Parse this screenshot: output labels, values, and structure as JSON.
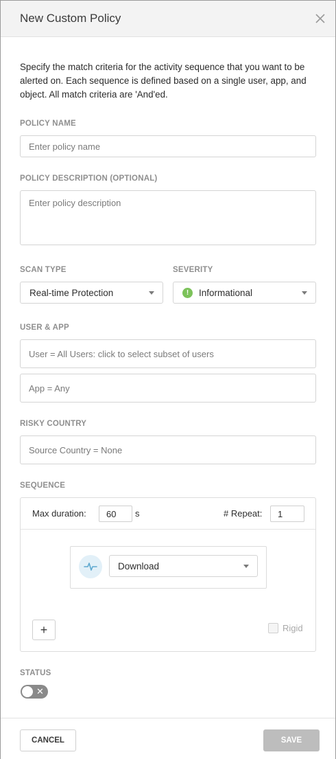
{
  "dialog": {
    "title": "New Custom Policy",
    "intro": "Specify the match criteria for the activity sequence that you want to be alerted on. Each sequence is defined based on a single user, app, and object. All match criteria are 'And'ed."
  },
  "policy_name": {
    "label": "POLICY NAME",
    "placeholder": "Enter policy name"
  },
  "policy_description": {
    "label": "POLICY DESCRIPTION (OPTIONAL)",
    "placeholder": "Enter policy description"
  },
  "scan_type": {
    "label": "SCAN TYPE",
    "value": "Real-time Protection"
  },
  "severity": {
    "label": "SEVERITY",
    "value": "Informational",
    "icon": "info-icon",
    "color": "#7cc25a"
  },
  "user_app": {
    "label": "USER & APP",
    "user": "User = All Users: click to select subset of users",
    "app": "App = Any"
  },
  "risky_country": {
    "label": "RISKY COUNTRY",
    "source": "Source Country = None"
  },
  "sequence": {
    "label": "SEQUENCE",
    "max_duration_label": "Max duration:",
    "max_duration_value": "60",
    "duration_unit": "s",
    "repeat_label": "# Repeat:",
    "repeat_value": "1",
    "activity": {
      "icon": "activity-pulse-icon",
      "value": "Download"
    },
    "add_icon": "plus-icon",
    "add_label": "+",
    "rigid_label": "Rigid",
    "rigid_checked": false
  },
  "status": {
    "label": "STATUS",
    "enabled": false,
    "off_glyph": "✕"
  },
  "footer": {
    "cancel": "CANCEL",
    "save": "SAVE"
  },
  "colors": {
    "header_bg": "#f3f3f3",
    "save_disabled": "#bdbdbd",
    "label_gray": "#8f8f8f",
    "activity_icon_bg": "#e2f0f8",
    "activity_icon_stroke": "#5ea8cf"
  }
}
